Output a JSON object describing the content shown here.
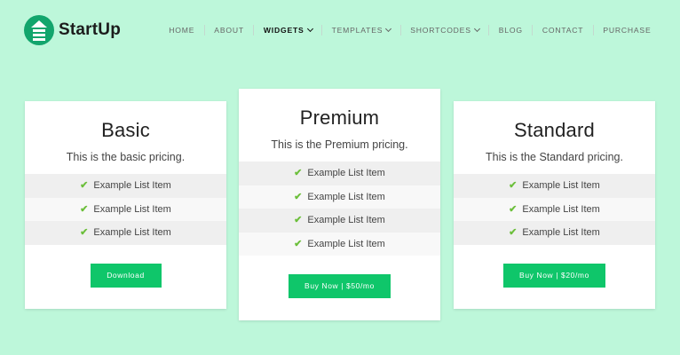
{
  "brand": {
    "name": "StartUp",
    "accent": "#12a56c",
    "background": "#bdf7da",
    "button_color": "#0fc66a",
    "check_color": "#6cbf3b"
  },
  "nav": {
    "items": [
      {
        "label": "HOME"
      },
      {
        "label": "ABOUT"
      },
      {
        "label": "WIDGETS",
        "dropdown": true,
        "active": true
      },
      {
        "label": "TEMPLATES",
        "dropdown": true
      },
      {
        "label": "SHORTCODES",
        "dropdown": true
      },
      {
        "label": "BLOG"
      },
      {
        "label": "CONTACT"
      },
      {
        "label": "PURCHASE"
      }
    ]
  },
  "pricing": {
    "basic": {
      "title": "Basic",
      "description": "This is the basic pricing.",
      "items": [
        "Example List Item",
        "Example List Item",
        "Example List Item"
      ],
      "button": "Download"
    },
    "premium": {
      "title": "Premium",
      "description": "This is the Premium pricing.",
      "items": [
        "Example List Item",
        "Example List Item",
        "Example List Item",
        "Example List Item"
      ],
      "button": "Buy Now | $50/mo"
    },
    "standard": {
      "title": "Standard",
      "description": "This is the Standard pricing.",
      "items": [
        "Example List Item",
        "Example List Item",
        "Example List Item"
      ],
      "button": "Buy Now | $20/mo"
    },
    "check_icon": "check-icon"
  }
}
